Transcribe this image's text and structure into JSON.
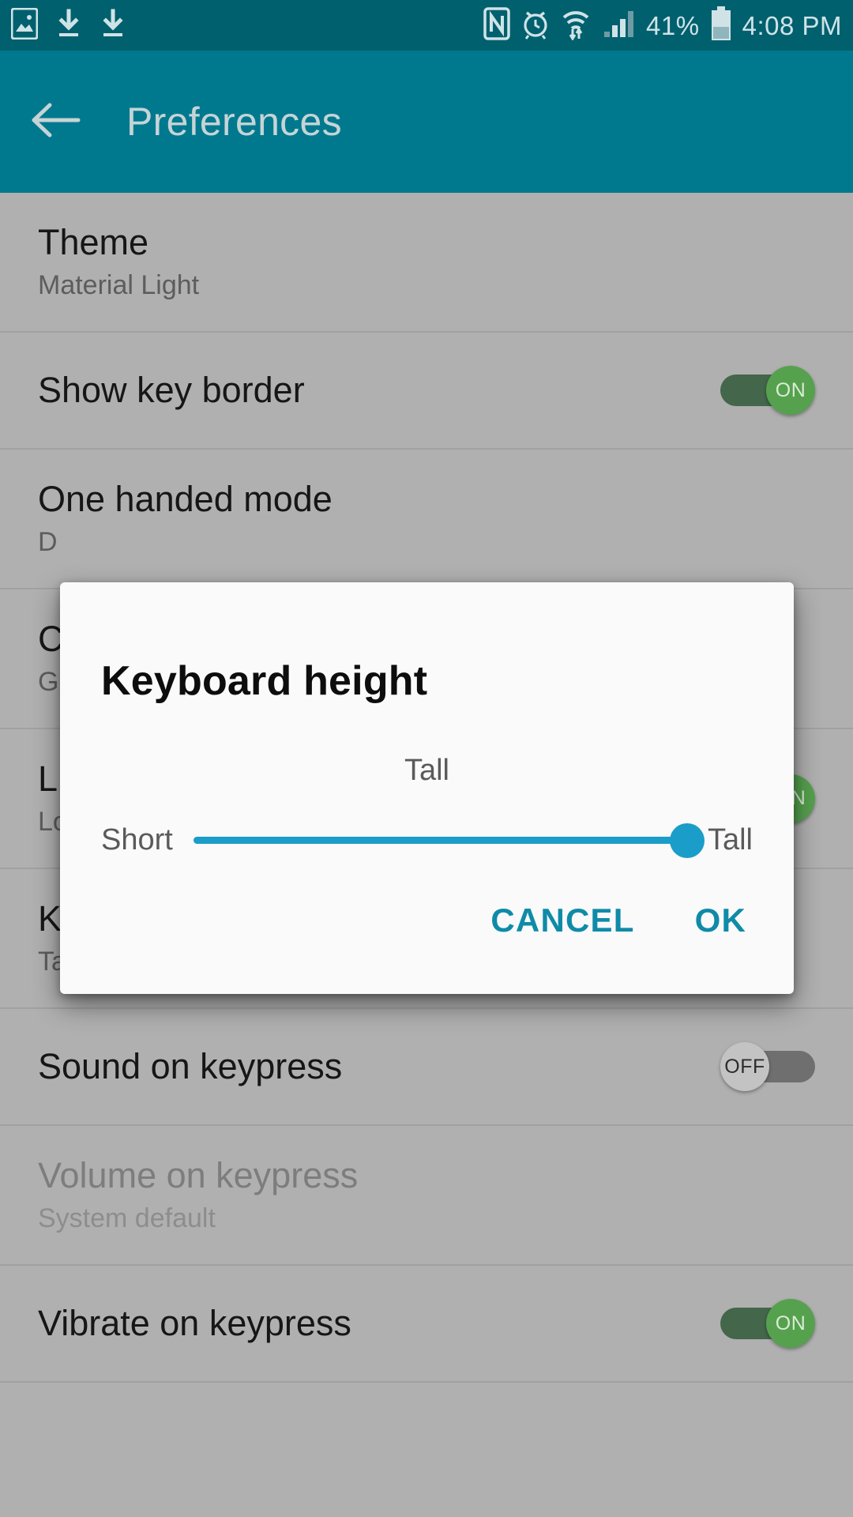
{
  "status_bar": {
    "time": "4:08 PM",
    "battery_percent": "41%",
    "icons": [
      "screenshot-image-icon",
      "download-icon",
      "download-icon",
      "nfc-icon",
      "alarm-clock-icon",
      "wifi-data-transfer-icon",
      "cellular-signal-icon",
      "battery-icon"
    ],
    "background_color": "#00606e"
  },
  "app_bar": {
    "back_label": "back-arrow",
    "title": "Preferences",
    "background_color": "#00798f"
  },
  "preferences": {
    "rows": [
      {
        "title": "Theme",
        "subtitle": "Material Light",
        "control": "none",
        "disabled": false
      },
      {
        "title": "Show key border",
        "subtitle": "",
        "control": "toggle",
        "toggle_label": "ON",
        "toggle_state": "on",
        "disabled": false
      },
      {
        "title": "One handed mode",
        "subtitle": "D",
        "control": "none",
        "disabled": false
      },
      {
        "title": "C",
        "subtitle": "G",
        "control": "none",
        "disabled": false
      },
      {
        "title": "L",
        "subtitle": "Lo",
        "control": "toggle",
        "toggle_label": "ON",
        "toggle_state": "on",
        "disabled": false
      },
      {
        "title": "Keyboard height",
        "subtitle": "Tall",
        "control": "none",
        "disabled": false
      },
      {
        "title": "Sound on keypress",
        "subtitle": "",
        "control": "toggle",
        "toggle_label": "OFF",
        "toggle_state": "off",
        "disabled": false
      },
      {
        "title": "Volume on keypress",
        "subtitle": "System default",
        "control": "none",
        "disabled": true
      },
      {
        "title": "Vibrate on keypress",
        "subtitle": "",
        "control": "toggle",
        "toggle_label": "ON",
        "toggle_state": "on",
        "disabled": false
      }
    ]
  },
  "dialog": {
    "title": "Keyboard height",
    "current_value": "Tall",
    "min_label": "Short",
    "max_label": "Tall",
    "slider_percent": 100,
    "cancel_label": "CANCEL",
    "ok_label": "OK",
    "accent_color": "#1a9dc8",
    "button_color": "#0f8ba8"
  }
}
